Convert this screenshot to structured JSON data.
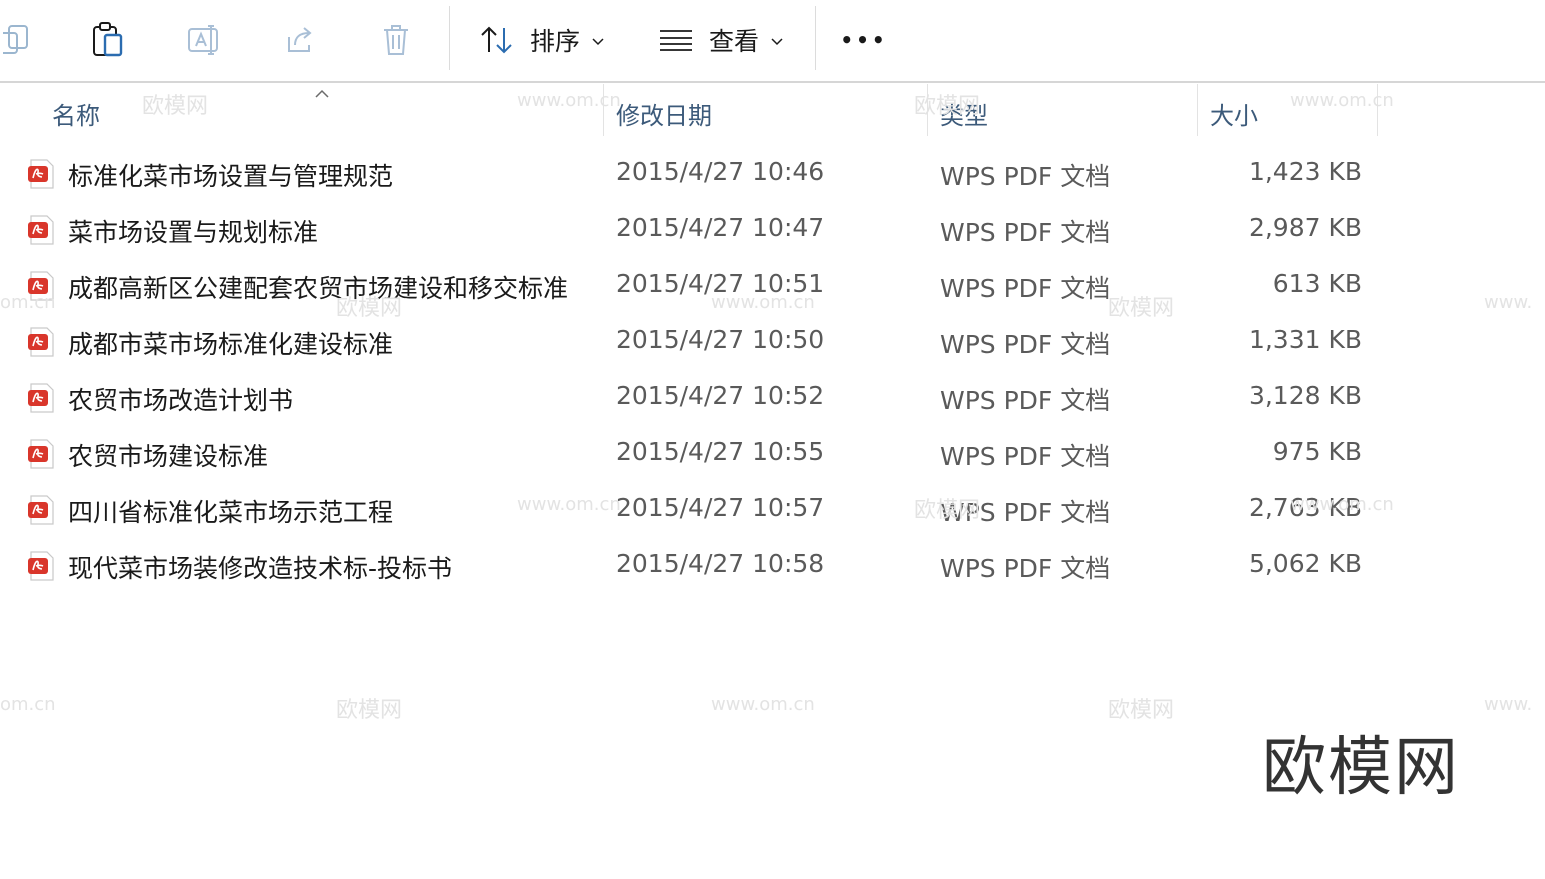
{
  "toolbar": {
    "sort_label": "排序",
    "view_label": "查看",
    "more_label": "•••",
    "icons": [
      "copy-icon",
      "paste-icon",
      "rename-icon",
      "share-icon",
      "delete-icon",
      "sort-icon",
      "view-icon",
      "more-icon"
    ]
  },
  "columns": {
    "name": "名称",
    "date": "修改日期",
    "type": "类型",
    "size": "大小"
  },
  "files": [
    {
      "name": "标准化菜市场设置与管理规范",
      "date": "2015/4/27 10:46",
      "type": "WPS PDF 文档",
      "size": "1,423 KB"
    },
    {
      "name": "菜市场设置与规划标准",
      "date": "2015/4/27 10:47",
      "type": "WPS PDF 文档",
      "size": "2,987 KB"
    },
    {
      "name": "成都高新区公建配套农贸市场建设和移交标准",
      "date": "2015/4/27 10:51",
      "type": "WPS PDF 文档",
      "size": "613 KB"
    },
    {
      "name": "成都市菜市场标准化建设标准",
      "date": "2015/4/27 10:50",
      "type": "WPS PDF 文档",
      "size": "1,331 KB"
    },
    {
      "name": "农贸市场改造计划书",
      "date": "2015/4/27 10:52",
      "type": "WPS PDF 文档",
      "size": "3,128 KB"
    },
    {
      "name": "农贸市场建设标准",
      "date": "2015/4/27 10:55",
      "type": "WPS PDF 文档",
      "size": "975 KB"
    },
    {
      "name": "四川省标准化菜市场示范工程",
      "date": "2015/4/27 10:57",
      "type": "WPS PDF 文档",
      "size": "2,763 KB"
    },
    {
      "name": "现代菜市场装修改造技术标-投标书",
      "date": "2015/4/27 10:58",
      "type": "WPS PDF 文档",
      "size": "5,062 KB"
    }
  ],
  "watermark": {
    "brand": "欧模网",
    "url": "www.om.cn",
    "url_short": "om.cn",
    "url_prefix": "www."
  },
  "colors": {
    "header_text": "#3c5a7a",
    "pdf_red": "#d9362b",
    "divider": "#d6d6d6"
  }
}
